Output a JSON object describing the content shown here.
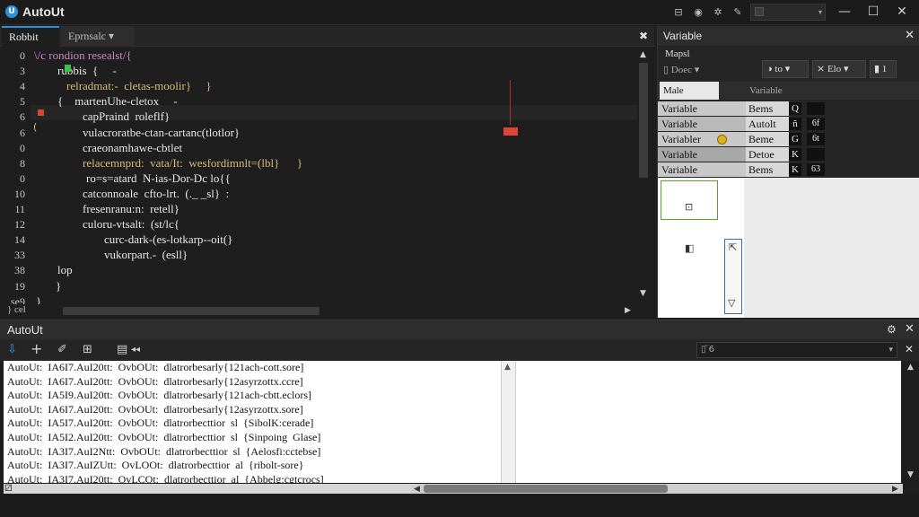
{
  "app": {
    "title": "AutoUt",
    "logo": "U"
  },
  "titlebar": {
    "icons": [
      "lock-icon",
      "globe-icon",
      "cursor-icon",
      "pin-icon"
    ],
    "glyphs": [
      "⊟",
      "◉",
      "✲",
      "✎"
    ],
    "combo_arrow": "▾",
    "minimize": "—",
    "maximize": "☐",
    "close": "✕"
  },
  "editor": {
    "tabs": [
      {
        "label": "Robbit",
        "active": true
      },
      {
        "label": "Eprnsalc ▾",
        "active": false
      }
    ],
    "close_glyph": "✖",
    "line_numbers": [
      "0",
      "3",
      "4",
      "5",
      "6",
      "6",
      "0",
      "8",
      "0",
      "10",
      "11",
      "12",
      "14",
      "33",
      "38",
      "19",
      "se9",
      "Ɨ"
    ],
    "lines": [
      "\\/c rondion resealst/{",
      "rubbis  {     -",
      "relradmat:-  cletas-moolir}     }",
      "{    martenUhe-cletox     -",
      "capPraind  roleflf}",
      "vulacroratbe-ctan-cartanc(tlotlor}",
      "craeonamhawe-cbtlet",
      "relacemnprd:  vata/It:  wesfordimnlt=(lbl}      }",
      "ro=s=atard  N-ias-Dor-Dc lo{{",
      "catconnoale  cfto-lrt.  (._ _sl}  :",
      "fresenranu:n:  retell}",
      "culoru-vtsalt:  (st/lc{",
      "curc-dark-(es-lotkarp--oit(}",
      "vukorpart.-  (esll}",
      "lop",
      "}",
      "}",
      "}"
    ],
    "hscroll_label": "} cel"
  },
  "variables": {
    "title": "Variable",
    "close": "✕",
    "subtitle": "Mapsl",
    "dropdown": "▯ Doec ▾",
    "tools": [
      "◑ to ▾",
      "⨯ Elo ▾",
      "▮ 1"
    ],
    "columns": [
      "Male",
      "Variable"
    ],
    "rows": [
      {
        "name": "Variable",
        "type": "Bems",
        "v1": "Q",
        "v2": ""
      },
      {
        "name": "Variable",
        "type": "Autolt",
        "v1": "ñ",
        "v2": "6f"
      },
      {
        "name": "Variabler",
        "type": "Beme",
        "v1": "G",
        "v2": "6t"
      },
      {
        "name": "Variable",
        "type": "Detoe",
        "v1": "K",
        "v2": ""
      },
      {
        "name": "Variable",
        "type": "Bems",
        "v1": "K",
        "v2": "63"
      }
    ],
    "preview_icons": [
      "⊡",
      "◧",
      "⇱",
      "▽"
    ]
  },
  "output": {
    "title": "AutoUt",
    "tool_glyphs": [
      "⇩",
      "+",
      "✐",
      "⊞",
      "▤",
      "◂◂"
    ],
    "combo": "▯  ̈6",
    "combo_arrow": "▾",
    "close": "✕",
    "gear": "⚙",
    "log": [
      "AutoUt:  IA6I7.AuI20tt:  OvbOUt:  dlatrorbesarly{121ach-cott.sore]",
      "AutoUt:  IA6I7.AuI20tt:  OvbOUt:  dlatrorbesarly{12asyrzottx.ccre]",
      "AutoUt:  IA5I9.AuI20tt:  OvbOUt:  dlatrorbesarly{121ach-cbtt.eclors]",
      "AutoUt:  IA6I7.AuI20tt:  OvbOUt:  dlatrorbesarly{12asyrzottx.sore]",
      "AutoUt:  IA5I7.AuI20tt:  OvbOUt:  dlatrorbecttior  sl  {SibolK:cerade]",
      "AutoUt:  IA5I2.AuI20tt:  OvbOUt:  dlatrorbecttior  sl  {Sinpoing  Glase]",
      "AutoUt:  IA3I7.AuI2Ntt:  OvbOUt:  dlatrorbecttior  sl  {Aelosfi:cctebse]",
      "AutoUt:  IA3I7.AuIZUtt:  OvLOOt:  dlatrorbecttior  al  {ribolt-sore}",
      "AutoUt:  IA3I7.AuI20tt:  OvLCOt:  dlatrorbecttior  al  {Abbelg:cgtcrocs]"
    ],
    "footer_glyph": "⚂"
  },
  "colors": {
    "accent": "#2f8fd8",
    "error": "#e0453a",
    "breakpoint_ok": "#38c24a"
  }
}
